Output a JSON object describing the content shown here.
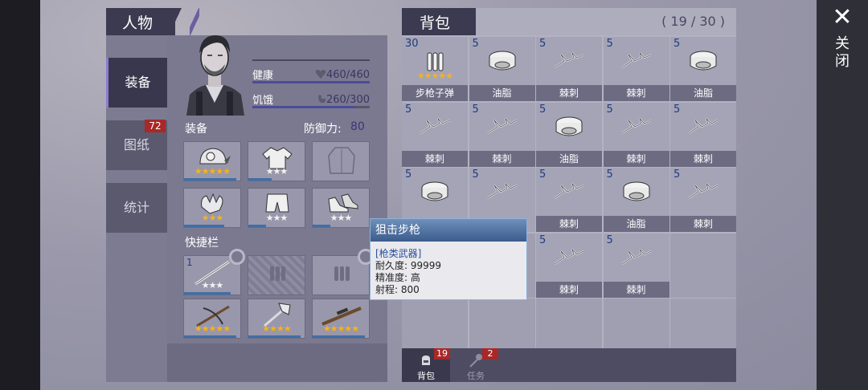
{
  "close": {
    "label": "关闭"
  },
  "character": {
    "title": "人物",
    "tabs": [
      {
        "label": "装备",
        "active": true
      },
      {
        "label": "图纸",
        "badge": "72"
      },
      {
        "label": "统计"
      }
    ],
    "stats": [
      {
        "label": "健康",
        "value": "460/460",
        "fraction": 1.0,
        "icon": "heart-icon"
      },
      {
        "label": "饥饿",
        "value": "260/300",
        "fraction": 0.867,
        "icon": "stomach-icon"
      }
    ],
    "equipment": {
      "label": "装备",
      "defense_label": "防御力:",
      "defense_value": "80",
      "slots": [
        {
          "icon": "mining-helmet-icon",
          "stars": "★★★★★",
          "star_color": "gold",
          "durability": 0.9
        },
        {
          "icon": "tshirt-icon",
          "stars": "★★★",
          "star_color": "white",
          "durability": 0.4
        },
        {
          "icon": "jacket-icon",
          "stars": "",
          "star_color": "none",
          "durability": 0
        },
        {
          "icon": "gloves-icon",
          "stars": "★★★",
          "star_color": "gold",
          "durability": 0.7
        },
        {
          "icon": "shorts-icon",
          "stars": "★★★",
          "star_color": "white",
          "durability": 0.3
        },
        {
          "icon": "sneakers-icon",
          "stars": "★★★",
          "star_color": "white",
          "durability": 0.3
        }
      ]
    },
    "quickbar": {
      "label": "快捷栏",
      "slots": [
        {
          "icon": "spear-icon",
          "count": "1",
          "stars": "★★★",
          "star_color": "white",
          "durability": 0.8
        },
        {
          "icon": "bullets-icon",
          "count": "",
          "stars": "",
          "star_color": "none",
          "durability": 0
        },
        {
          "icon": "bullets-icon",
          "count": "",
          "stars": "",
          "star_color": "none",
          "durability": 0
        },
        {
          "icon": "crossbow-icon",
          "count": "",
          "stars": "★★★★★",
          "star_color": "gold",
          "durability": 0.9
        },
        {
          "icon": "axe-icon",
          "count": "",
          "stars": "★★★★",
          "star_color": "gold",
          "durability": 0.9
        },
        {
          "icon": "sniper-rifle-icon",
          "count": "",
          "stars": "★★★★★",
          "star_color": "gold",
          "durability": 0.9
        }
      ]
    }
  },
  "backpack": {
    "title": "背包",
    "capacity": "( 19 / 30 )",
    "items": [
      {
        "name": "步枪子弹",
        "count": "30",
        "icon": "rifle-ammo-icon",
        "stars": "★★★★★"
      },
      {
        "name": "油脂",
        "count": "5",
        "icon": "grease-can-icon"
      },
      {
        "name": "棘刺",
        "count": "5",
        "icon": "spike-wire-icon"
      },
      {
        "name": "棘刺",
        "count": "5",
        "icon": "spike-wire-icon"
      },
      {
        "name": "油脂",
        "count": "5",
        "icon": "grease-can-icon"
      },
      {
        "name": "棘刺",
        "count": "5",
        "icon": "spike-wire-icon"
      },
      {
        "name": "棘刺",
        "count": "5",
        "icon": "spike-wire-icon"
      },
      {
        "name": "油脂",
        "count": "5",
        "icon": "grease-can-icon"
      },
      {
        "name": "棘刺",
        "count": "5",
        "icon": "spike-wire-icon"
      },
      {
        "name": "棘刺",
        "count": "5",
        "icon": "spike-wire-icon"
      },
      {
        "name": "",
        "count": "5",
        "icon": "grease-can-icon"
      },
      {
        "name": "",
        "count": "5",
        "icon": "spike-wire-icon"
      },
      {
        "name": "棘刺",
        "count": "5",
        "icon": "spike-wire-icon"
      },
      {
        "name": "油脂",
        "count": "5",
        "icon": "grease-can-icon"
      },
      {
        "name": "棘刺",
        "count": "5",
        "icon": "spike-wire-icon"
      },
      {
        "name": "",
        "count": "",
        "icon": ""
      },
      {
        "name": "",
        "count": "",
        "icon": ""
      },
      {
        "name": "棘刺",
        "count": "5",
        "icon": "spike-wire-icon"
      },
      {
        "name": "棘刺",
        "count": "5",
        "icon": "spike-wire-icon"
      },
      {
        "name": "",
        "count": "",
        "icon": ""
      },
      {
        "name": "",
        "count": "",
        "icon": ""
      },
      {
        "name": "",
        "count": "",
        "icon": ""
      },
      {
        "name": "",
        "count": "",
        "icon": ""
      },
      {
        "name": "",
        "count": "",
        "icon": ""
      },
      {
        "name": "",
        "count": "",
        "icon": ""
      }
    ],
    "footer_tabs": [
      {
        "label": "背包",
        "badge": "19",
        "icon": "backpack-icon",
        "active": true
      },
      {
        "label": "任务",
        "badge": "2",
        "icon": "quest-pin-icon",
        "active": false
      }
    ]
  },
  "tooltip": {
    "title": "狙击步枪",
    "category": "[枪类武器]",
    "lines": [
      "耐久度: 99999",
      "精准度: 高",
      "射程: 800"
    ]
  }
}
